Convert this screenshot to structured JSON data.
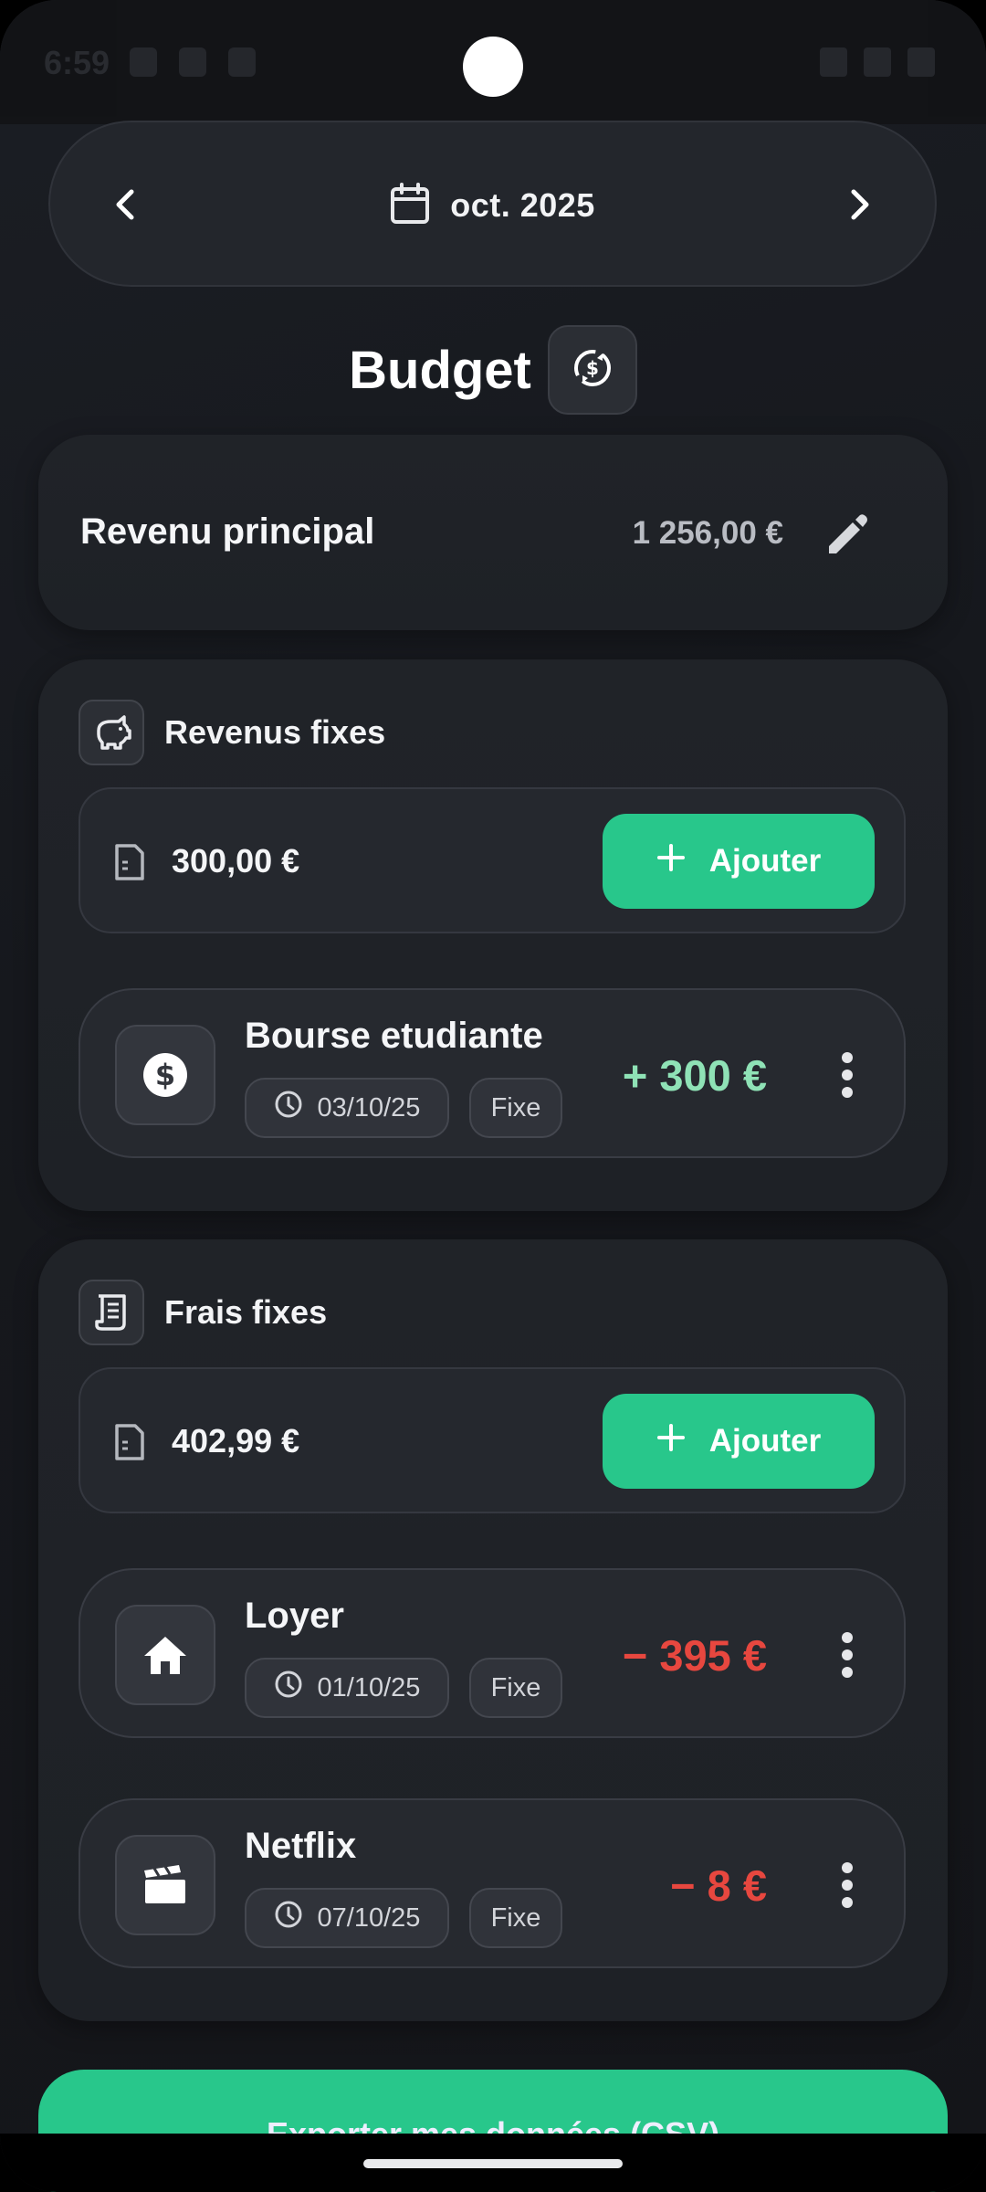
{
  "status_bar": {
    "time": "6:59"
  },
  "month_selector": {
    "label": "oct. 2025",
    "prev_icon": "chevron-left-icon",
    "next_icon": "chevron-right-icon",
    "calendar_icon": "calendar-icon"
  },
  "page": {
    "title": "Budget",
    "sync_icon": "sync-icon"
  },
  "main_income": {
    "label": "Revenu principal",
    "value": "1 256,00 €",
    "edit_icon": "pencil-icon"
  },
  "fixed_income": {
    "title": "Revenus fixes",
    "icon": "piggy-bank-icon",
    "total": "300,00 €",
    "add_label": "Ajouter",
    "entries": [
      {
        "title": "Bourse etudiante",
        "date": "03/10/25",
        "type": "Fixe",
        "amount": "+ 300 €",
        "icon": "dollar-icon"
      }
    ]
  },
  "fixed_costs": {
    "title": "Frais fixes",
    "icon": "receipt-icon",
    "total": "402,99 €",
    "add_label": "Ajouter",
    "entries": [
      {
        "title": "Loyer",
        "date": "01/10/25",
        "type": "Fixe",
        "amount": "− 395 €",
        "icon": "home-icon"
      },
      {
        "title": "Netflix",
        "date": "07/10/25",
        "type": "Fixe",
        "amount": "− 8 €",
        "icon": "clapperboard-icon"
      }
    ]
  },
  "export": {
    "label": "Exporter mes données (CSV)"
  },
  "colors": {
    "accent": "#28c78b",
    "positive": "#8fe2b6",
    "negative": "#e7473f",
    "background": "#16181d"
  }
}
